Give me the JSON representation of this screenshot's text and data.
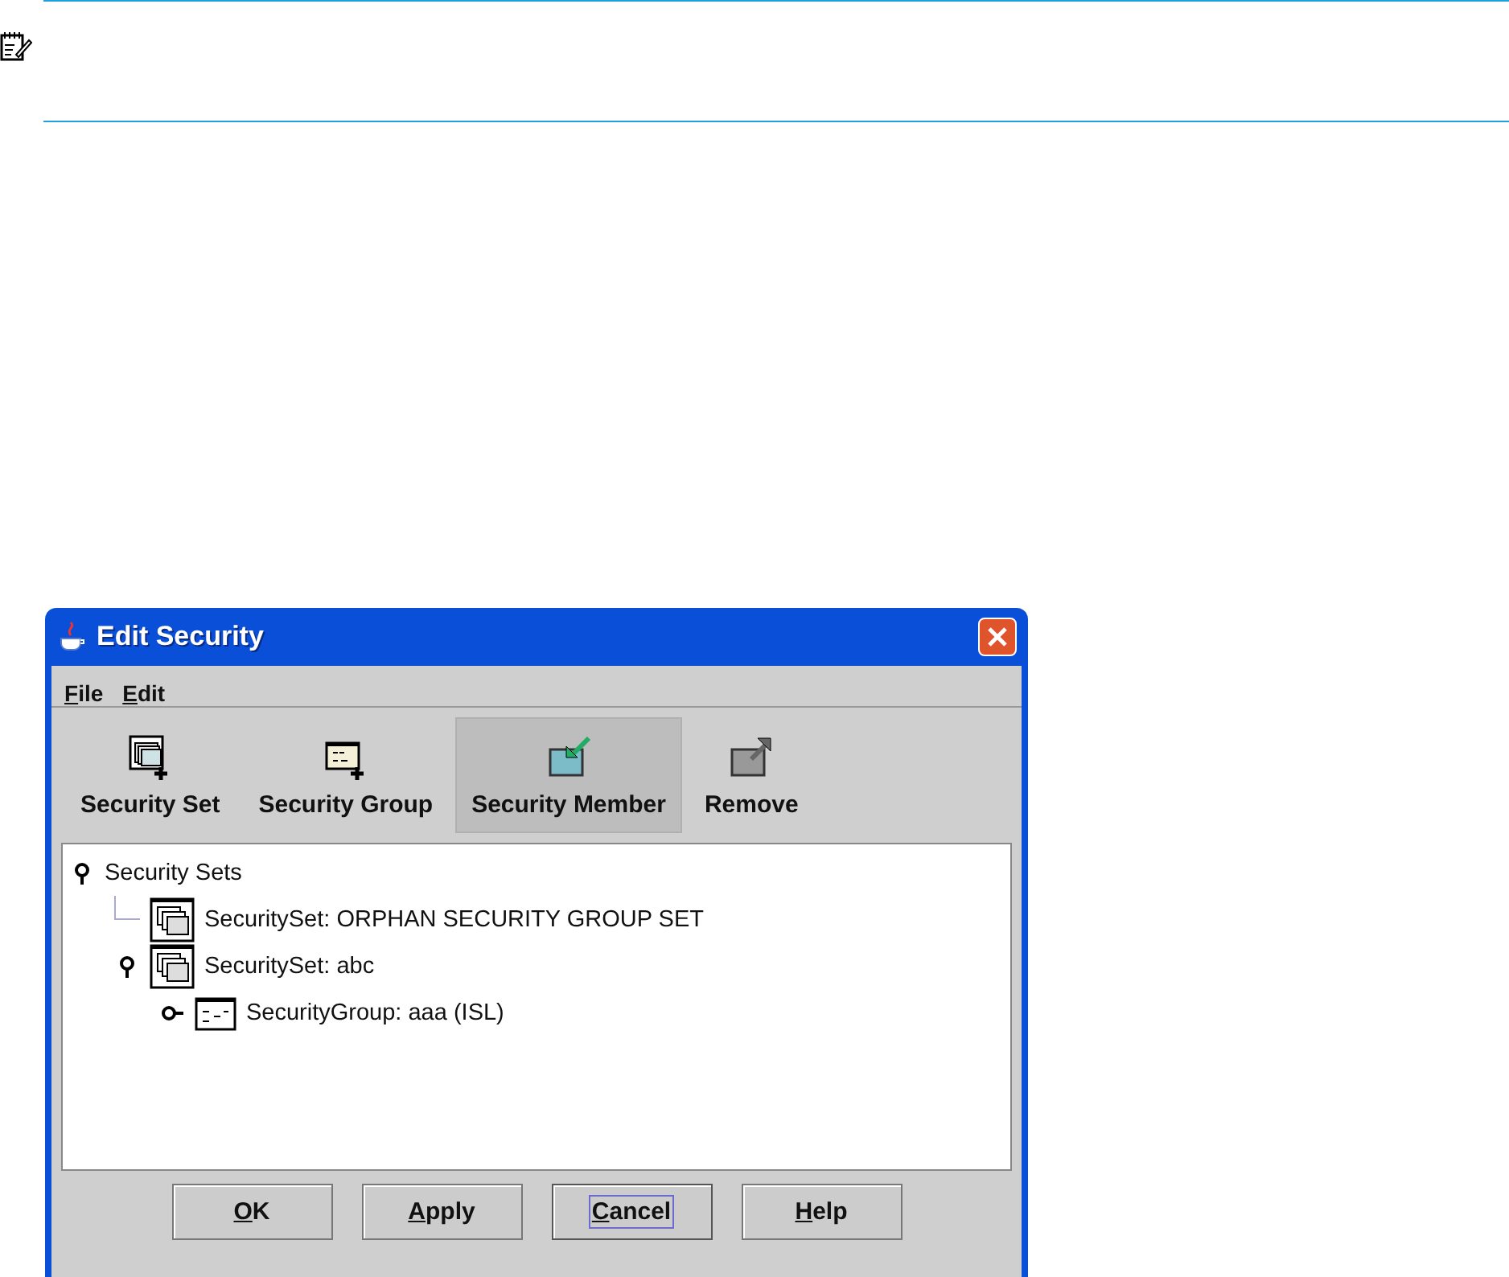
{
  "note": {
    "kind": "note"
  },
  "window": {
    "title": "Edit Security"
  },
  "menu": [
    {
      "label": "File",
      "mnemonic": true
    },
    {
      "label": "Edit",
      "mnemonic": true
    }
  ],
  "toolbar": [
    {
      "label": "Security Set",
      "kind": "set-add",
      "highlighted": false
    },
    {
      "label": "Security Group",
      "kind": "group-add",
      "highlighted": false
    },
    {
      "label": "Security Member",
      "kind": "member-add",
      "highlighted": true
    },
    {
      "label": "Remove",
      "kind": "remove",
      "highlighted": false
    }
  ],
  "tree": [
    {
      "label": "Security Sets",
      "expanded": true,
      "children": [
        {
          "label": "SecuritySet: ORPHAN SECURITY GROUP SET",
          "kind": "set"
        },
        {
          "label": "SecuritySet: abc",
          "kind": "set",
          "expanded": true,
          "children": [
            {
              "label": "SecurityGroup: aaa (ISL)",
              "kind": "group",
              "expanded": false
            }
          ]
        }
      ]
    }
  ],
  "buttons": [
    {
      "label": "OK",
      "focused": false
    },
    {
      "label": "Apply",
      "focused": false
    },
    {
      "label": "Cancel",
      "focused": true
    },
    {
      "label": "Help",
      "focused": false
    }
  ]
}
